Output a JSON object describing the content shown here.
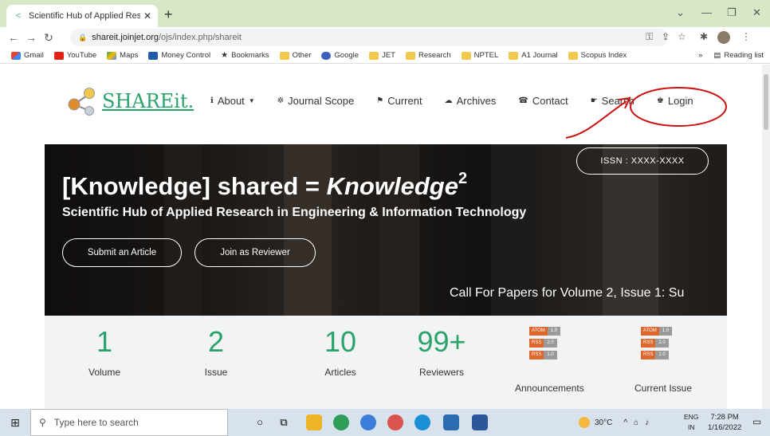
{
  "browser": {
    "tab_title": "Scientific Hub of Applied Researc",
    "tab_close": "✕",
    "new_tab": "+",
    "url_domain": "shareit.joinjet.org",
    "url_path": "/ojs/index.php/shareit",
    "bookmarks": [
      "Gmail",
      "YouTube",
      "Maps",
      "Money Control",
      "Bookmarks",
      "Other",
      "Google",
      "JET",
      "Research",
      "NPTEL",
      "A1 Journal",
      "Scopus Index"
    ],
    "reading_list": "Reading list",
    "more_bookmarks": "»"
  },
  "site": {
    "logo_text": "SHAREit.",
    "nav": [
      {
        "label": "About",
        "icon": "info-icon"
      },
      {
        "label": "Journal Scope",
        "icon": "gear-icon"
      },
      {
        "label": "Current",
        "icon": "flag-icon"
      },
      {
        "label": "Archives",
        "icon": "cloud-icon"
      },
      {
        "label": "Contact",
        "icon": "phone-icon"
      },
      {
        "label": "Search",
        "icon": "hand-pointer-icon"
      },
      {
        "label": "Login",
        "icon": "user-icon"
      }
    ],
    "nav_caret": "▼"
  },
  "hero": {
    "title_part1": "[Knowledge] shared = ",
    "title_part2": "Knowledge",
    "title_sup": "2",
    "subtitle": "Scientific Hub of Applied Research in Engineering & Information Technology",
    "submit_label": "Submit an Article",
    "reviewer_label": "Join as Reviewer",
    "issn_label": "ISSN : XXXX-XXXX",
    "cfp_text": "Call For Papers for Volume 2, Issue 1: Su"
  },
  "stats": [
    {
      "value": "1",
      "label": "Volume"
    },
    {
      "value": "2",
      "label": "Issue"
    },
    {
      "value": "10",
      "label": "Articles"
    },
    {
      "value": "99+",
      "label": "Reviewers"
    }
  ],
  "feeds": {
    "announcements_label": "Announcements",
    "current_issue_label": "Current Issue",
    "rows": [
      [
        "ATOM",
        "1.0"
      ],
      [
        "RSS",
        "2.0"
      ],
      [
        "RSS",
        "1.0"
      ]
    ]
  },
  "taskbar": {
    "search_placeholder": "Type here to search",
    "weather": "30°C",
    "lang_top": "ENG",
    "lang_bottom": "IN",
    "time": "7:28 PM",
    "date": "1/16/2022"
  },
  "colors": {
    "accent_green": "#2aa36b",
    "annotation_red": "#cc1111",
    "tab_strip": "#d8e8c6"
  }
}
